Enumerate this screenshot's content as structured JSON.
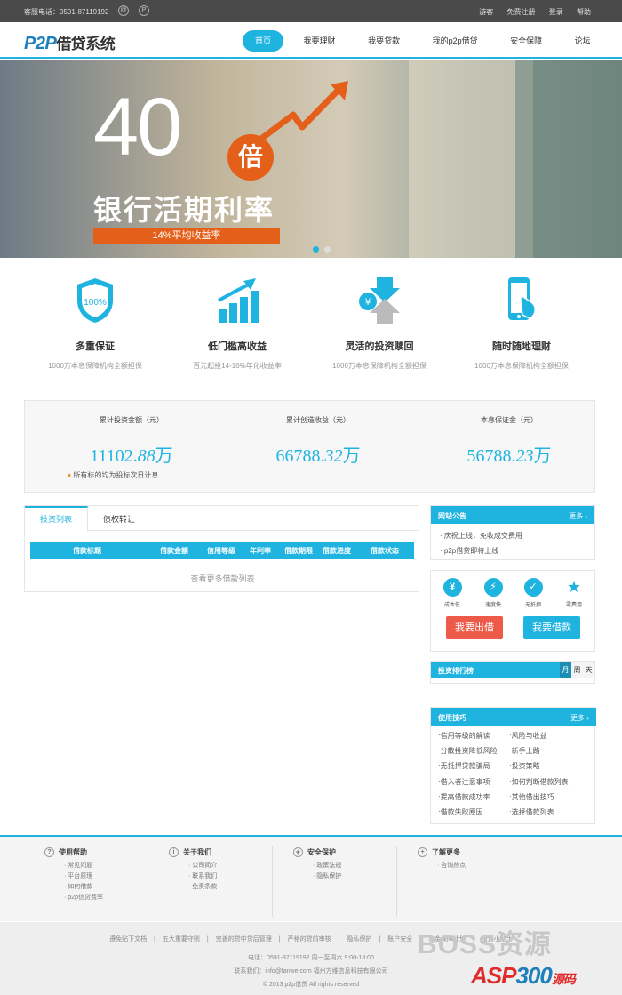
{
  "topbar": {
    "phone": "客服电话：0591-87119192",
    "weibo_icon": "weibo-icon",
    "p_icon": "p-icon",
    "links": [
      "游客",
      "免费注册",
      "登录",
      "帮助"
    ]
  },
  "header": {
    "logo": "P2P",
    "logo_text": "借贷系统",
    "nav": [
      "首页",
      "我要理财",
      "我要贷款",
      "我的p2p借贷",
      "安全保障",
      "论坛"
    ]
  },
  "banner": {
    "number": "40",
    "bei": "倍",
    "headline": "银行活期利率",
    "strip": "14%平均收益率"
  },
  "features": [
    {
      "icon": "shield-icon",
      "badge": "100%",
      "title": "多重保证",
      "desc": "1000万本息保障机构全额担保"
    },
    {
      "icon": "growth-chart-icon",
      "title": "低门槛高收益",
      "desc": "百元起投14-18%年化收益率"
    },
    {
      "icon": "exchange-icon",
      "title": "灵活的投资赎回",
      "desc": "1000万本息保障机构全额担保"
    },
    {
      "icon": "mobile-icon",
      "title": "随时随地理财",
      "desc": "1000万本息保障机构全额担保"
    }
  ],
  "stats": {
    "items": [
      {
        "label": "累计投资金额（元）",
        "int": "11102.",
        "dec": "88",
        "unit": "万"
      },
      {
        "label": "累计创造收益（元）",
        "int": "66788.",
        "dec": "32",
        "unit": "万"
      },
      {
        "label": "本息保证金（元）",
        "int": "56788.",
        "dec": "23",
        "unit": "万"
      }
    ],
    "note": "所有标的均为投标次日计息"
  },
  "loans": {
    "tabs": [
      "投资列表",
      "债权转让"
    ],
    "columns": [
      "借款标题",
      "借款金额",
      "信用等级",
      "年利率",
      "借款期限",
      "借款进度",
      "借款状态"
    ],
    "more": "查看更多借款列表"
  },
  "notice": {
    "title": "网站公告",
    "more": "更多 ›",
    "items": [
      "庆祝上线，免收成交费用",
      "p2p借贷即将上线"
    ]
  },
  "quick": {
    "items": [
      {
        "icon": "yen-icon",
        "glyph": "¥",
        "label": "成本低"
      },
      {
        "icon": "lightning-icon",
        "glyph": "⚡",
        "label": "速度快"
      },
      {
        "icon": "shield-check-icon",
        "glyph": "✓",
        "label": "无抵押"
      },
      {
        "icon": "star-icon",
        "glyph": "★",
        "label": "零费用"
      }
    ],
    "lend": "我要出借",
    "borrow": "我要借款"
  },
  "rank": {
    "title": "投资排行榜",
    "tabs": [
      "月",
      "周",
      "天"
    ]
  },
  "tips": {
    "title": "使用技巧",
    "more": "更多 ›",
    "left": [
      "信用等级的解读",
      "分散投资降低风险",
      "无抵押贷款骗局",
      "借入者注意事项",
      "提高借款成功率",
      "借款失败原因"
    ],
    "right": [
      "风险与收益",
      "新手上路",
      "投资策略",
      "如何判断借款列表",
      "其他借出技巧",
      "选择借款列表"
    ]
  },
  "footer": {
    "cols": [
      {
        "icon": "question-icon",
        "glyph": "?",
        "title": "使用帮助",
        "items": [
          "常见问题",
          "平台原理",
          "如何借款",
          "p2p信贷费率"
        ]
      },
      {
        "icon": "info-icon",
        "glyph": "i",
        "title": "关于我们",
        "items": [
          "公司简介",
          "联系我们",
          "免责条款"
        ]
      },
      {
        "icon": "shield-icon",
        "glyph": "◈",
        "title": "安全保护",
        "items": [
          "政策法规",
          "隐私保护"
        ]
      },
      {
        "icon": "plus-icon",
        "glyph": "+",
        "title": "了解更多",
        "items": [
          "咨询热点"
        ]
      }
    ],
    "links": [
      "遵免贴下文档",
      "五大重要守则",
      "完善的贷中贷后管理",
      "严格的贷前审核",
      "隐私保护",
      "账户安全",
      "本金保障计划",
      "投资小贴士"
    ],
    "phone": "电话：0591-87119192 周一至周六 9:00-18:00",
    "contact": "联系我们：info@fanwe.com   福州方维信息科技有限公司",
    "copyright": "© 2013 p2p借贷 All rights reserved"
  },
  "watermark": {
    "boss": "BOSS资源",
    "asp": "ASP",
    "num": "300",
    "src": "源码"
  }
}
